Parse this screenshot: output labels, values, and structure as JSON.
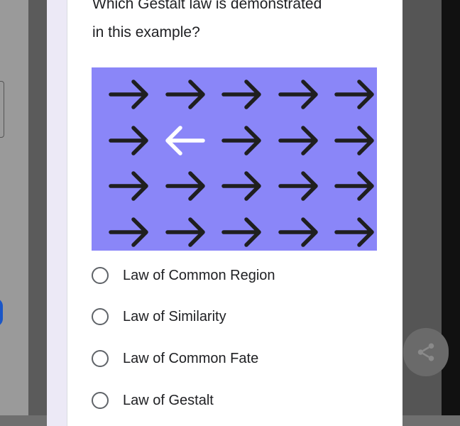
{
  "question": {
    "text": "Which Gestalt law is demonstrated\nin this example?",
    "required_marker": "*"
  },
  "image": {
    "background": "#8a86f8",
    "arrow_color": "#1f1f1f",
    "odd_arrow_color": "#ffffff",
    "grid": [
      [
        "right",
        "right",
        "right",
        "right",
        "right"
      ],
      [
        "right",
        "left",
        "right",
        "right",
        "right"
      ],
      [
        "right",
        "right",
        "right",
        "right",
        "right"
      ],
      [
        "right",
        "right",
        "right",
        "right",
        "right"
      ]
    ]
  },
  "options": [
    {
      "label": "Law of Common Region"
    },
    {
      "label": "Law of Similarity"
    },
    {
      "label": "Law of Common Fate"
    },
    {
      "label": "Law of Gestalt"
    }
  ],
  "colors": {
    "accent_blue": "#1a56c7",
    "required": "#d93025",
    "panel": "#ece9f6"
  },
  "fab": {
    "icon": "share-icon"
  }
}
